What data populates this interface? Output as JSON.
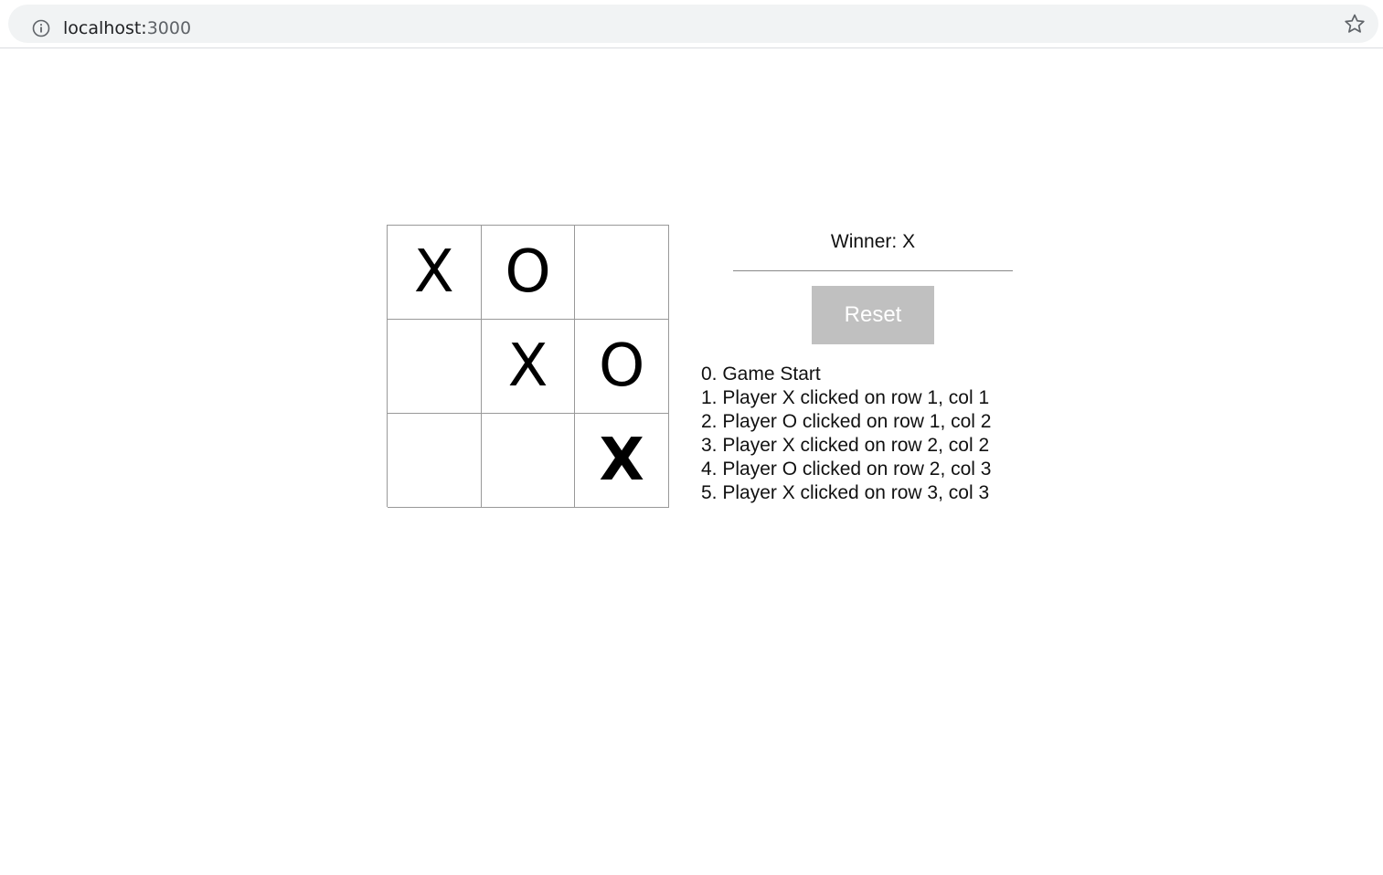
{
  "browser": {
    "host": "localhost:",
    "port": "3000",
    "info_icon": "info-icon",
    "bookmark_icon": "star-icon"
  },
  "board": {
    "rows": [
      [
        {
          "value": "X",
          "win": false
        },
        {
          "value": "O",
          "win": false
        },
        {
          "value": "",
          "win": false
        }
      ],
      [
        {
          "value": "",
          "win": false
        },
        {
          "value": "X",
          "win": false
        },
        {
          "value": "O",
          "win": false
        }
      ],
      [
        {
          "value": "",
          "win": false
        },
        {
          "value": "",
          "win": false
        },
        {
          "value": "X",
          "win": true
        }
      ]
    ]
  },
  "status": "Winner: X",
  "reset_label": "Reset",
  "moves": [
    "0. Game Start",
    "1. Player X clicked on row 1, col 1",
    "2. Player O clicked on row 1, col 2",
    "3. Player X clicked on row 2, col 2",
    "4. Player O clicked on row 2, col 3",
    "5. Player X clicked on row 3, col 3"
  ],
  "colors": {
    "omnibox_bg": "#f1f3f4",
    "button_bg": "#c0c0c0",
    "grid_line": "#999999"
  }
}
